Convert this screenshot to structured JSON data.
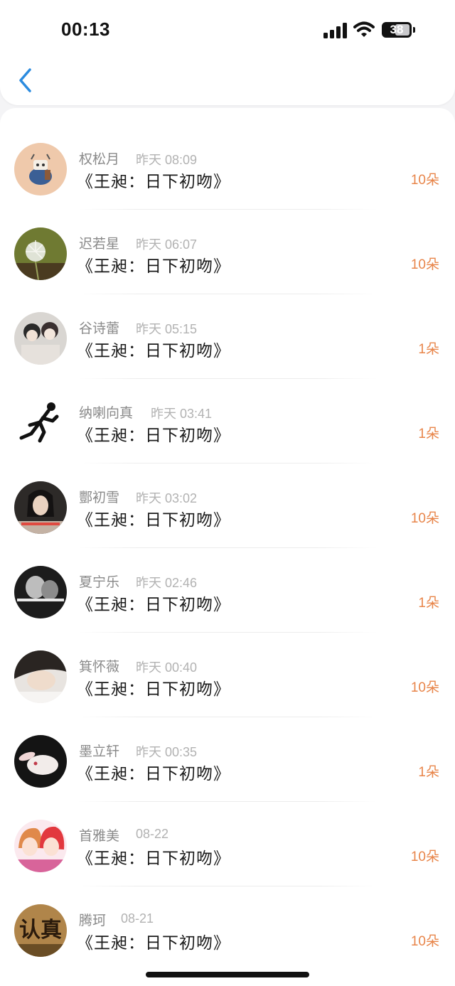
{
  "status_bar": {
    "time": "00:13",
    "battery": "38"
  },
  "colors": {
    "accent": "#2b8bdf",
    "count": "#e8854a"
  },
  "nav": {
    "back_icon": "chevron-left-icon"
  },
  "items": [
    {
      "name": "权松月",
      "time": "昨天 08:09",
      "title": "《王昶：日下初吻》",
      "count": "10朵",
      "avatar": "bunny-avatar"
    },
    {
      "name": "迟若星",
      "time": "昨天 06:07",
      "title": "《王昶：日下初吻》",
      "count": "10朵",
      "avatar": "dandelion-avatar"
    },
    {
      "name": "谷诗蕾",
      "time": "昨天 05:15",
      "title": "《王昶：日下初吻》",
      "count": "1朵",
      "avatar": "friends-photo-avatar"
    },
    {
      "name": "纳喇向真",
      "time": "昨天 03:41",
      "title": "《王昶：日下初吻》",
      "count": "1朵",
      "avatar": "runner-avatar"
    },
    {
      "name": "酆初雪",
      "time": "昨天 03:02",
      "title": "《王昶：日下初吻》",
      "count": "10朵",
      "avatar": "portrait-avatar"
    },
    {
      "name": "夏宁乐",
      "time": "昨天 02:46",
      "title": "《王昶：日下初吻》",
      "count": "1朵",
      "avatar": "bw-photo-avatar"
    },
    {
      "name": "箕怀薇",
      "time": "昨天 00:40",
      "title": "《王昶：日下初吻》",
      "count": "10朵",
      "avatar": "sleeping-person-avatar"
    },
    {
      "name": "墨立轩",
      "time": "昨天 00:35",
      "title": "《王昶：日下初吻》",
      "count": "1朵",
      "avatar": "rabbit-avatar"
    },
    {
      "name": "首雅美",
      "time": "08-22",
      "title": "《王昶：日下初吻》",
      "count": "10朵",
      "avatar": "anime-couple-avatar"
    },
    {
      "name": "腾珂",
      "time": "08-21",
      "title": "《王昶：日下初吻》",
      "count": "10朵",
      "avatar": "text-avatar",
      "avatar_text": "认真"
    }
  ]
}
